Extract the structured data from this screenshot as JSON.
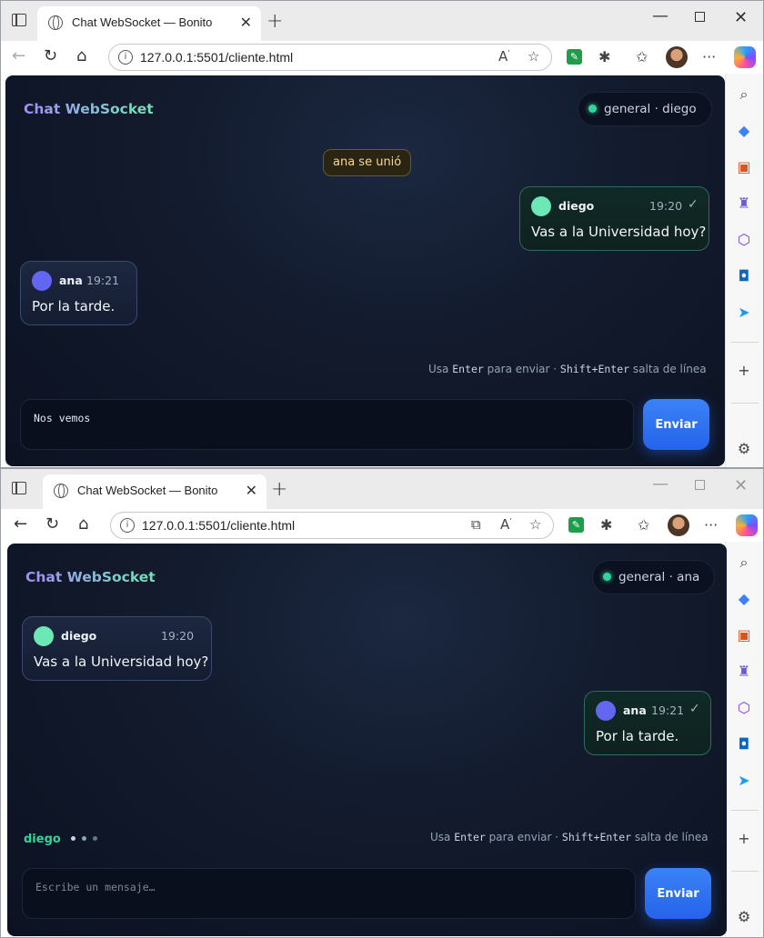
{
  "browser": {
    "tab_title": "Chat WebSocket — Bonito",
    "url": "127.0.0.1:5501/cliente.html"
  },
  "colors": {
    "accent": "#2563eb",
    "online": "#34d399",
    "avatar_diego": "#6ee7b7",
    "avatar_ana": "#6366f1",
    "system_text": "#fcd78a"
  },
  "app": {
    "title": "Chat WebSocket",
    "hint_prefix": "Usa",
    "hint_key1": "Enter",
    "hint_mid": "para enviar ·",
    "hint_key2": "Shift+Enter",
    "hint_suffix": "salta de línea",
    "send_label": "Enviar",
    "input_placeholder": "Escribe un mensaje…"
  },
  "window1": {
    "room_label": "general · diego",
    "system_message": "ana se unió",
    "messages": [
      {
        "author": "diego",
        "time": "19:20",
        "text": "Vas a la Universidad hoy?",
        "status": "✓"
      },
      {
        "author": "ana",
        "time": "19:21",
        "text": "Por la tarde."
      }
    ],
    "input_value": "Nos vemos"
  },
  "window2": {
    "room_label": "general · ana",
    "messages": [
      {
        "author": "diego",
        "time": "19:20",
        "text": "Vas a la Universidad hoy?"
      },
      {
        "author": "ana",
        "time": "19:21",
        "text": "Por la tarde.",
        "status": "✓"
      }
    ],
    "typing_user": "diego",
    "input_value": ""
  }
}
